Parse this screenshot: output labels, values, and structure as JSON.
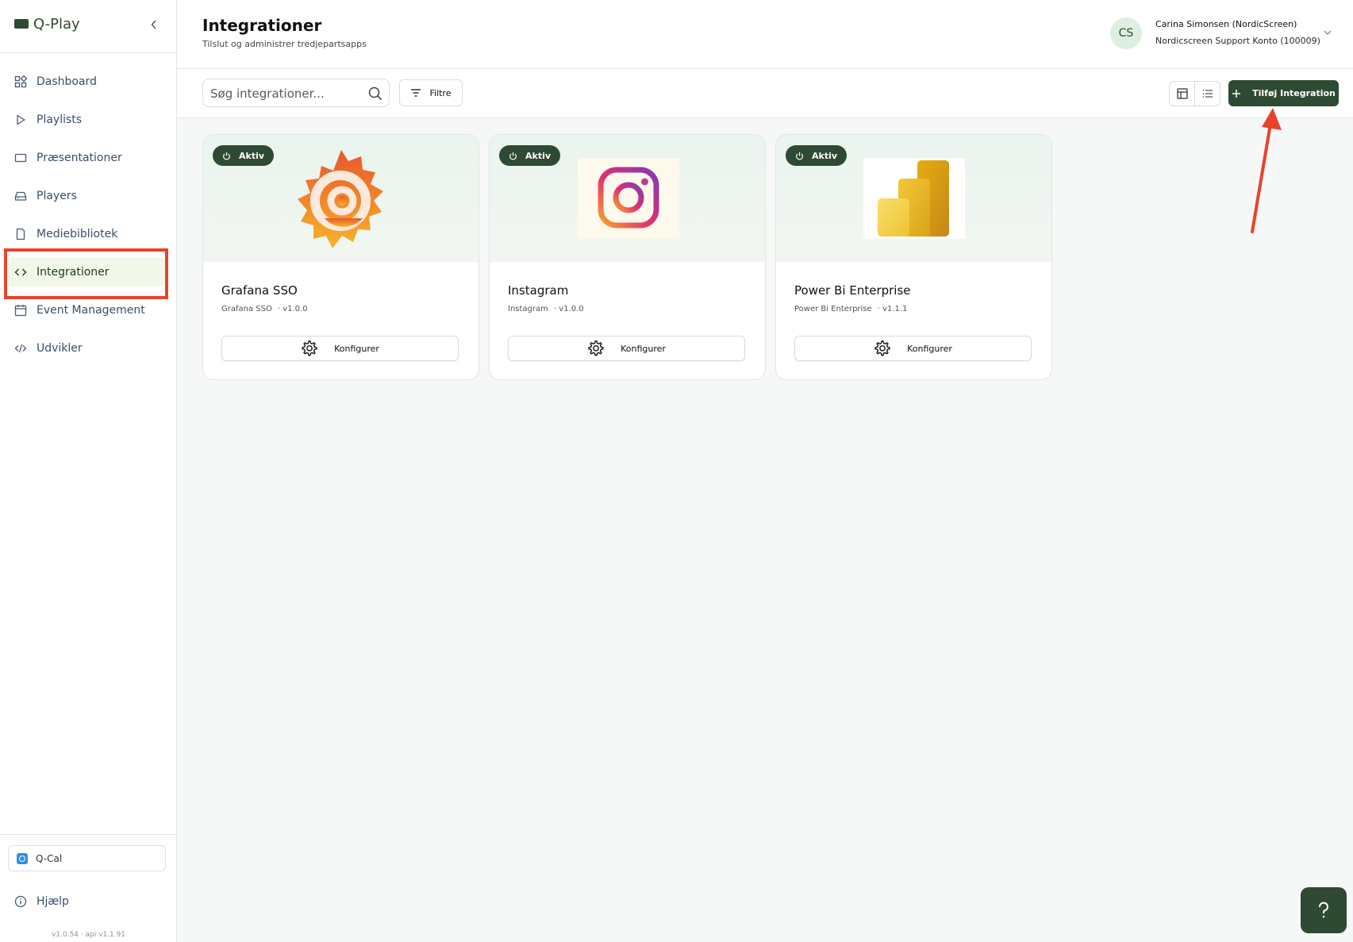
{
  "brand": {
    "name": "Q-Play"
  },
  "nav": {
    "items": [
      {
        "label": "Dashboard"
      },
      {
        "label": "Playlists"
      },
      {
        "label": "Præsentationer"
      },
      {
        "label": "Players"
      },
      {
        "label": "Mediebibliotek"
      },
      {
        "label": "Integrationer"
      },
      {
        "label": "Event Management"
      },
      {
        "label": "Udvikler"
      }
    ],
    "active": "Integrationer"
  },
  "sidebar_footer": {
    "qcal_label": "Q-Cal",
    "help_label": "Hjælp",
    "version": "v1.0.54 · api v1.1.91"
  },
  "header": {
    "title": "Integrationer",
    "subtitle": "Tilslut og administrer tredjepartsapps",
    "user": {
      "initials": "CS",
      "name": "Carina Simonsen (NordicScreen)",
      "account": "Nordicscreen Support Konto (100009)"
    }
  },
  "toolbar": {
    "search_placeholder": "Søg integrationer...",
    "filter_label": "Filtre",
    "add_label": "Tilføj Integration"
  },
  "integrations": [
    {
      "status": "Aktiv",
      "title": "Grafana SSO",
      "name": "Grafana SSO",
      "version": "· v1.0.0",
      "configure_label": "Konfigurer"
    },
    {
      "status": "Aktiv",
      "title": "Instagram",
      "name": "Instagram",
      "version": "· v1.0.0",
      "configure_label": "Konfigurer"
    },
    {
      "status": "Aktiv",
      "title": "Power Bi Enterprise",
      "name": "Power Bi Enterprise",
      "version": "· v1.1.1",
      "configure_label": "Konfigurer"
    }
  ],
  "colors": {
    "brand": "#2f4a33",
    "active_nav_bg": "#f2f8e7",
    "annotation": "#e8432a"
  }
}
